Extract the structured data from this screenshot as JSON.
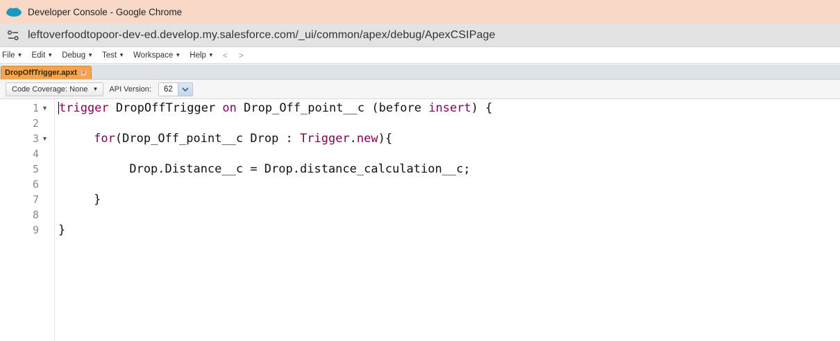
{
  "window": {
    "title": "Developer Console - Google Chrome",
    "url": "leftoverfoodtopoor-dev-ed.develop.my.salesforce.com/_ui/common/apex/debug/ApexCSIPage"
  },
  "menu": {
    "file": "File",
    "edit": "Edit",
    "debug": "Debug",
    "test": "Test",
    "workspace": "Workspace",
    "help": "Help",
    "back": "<",
    "forward": ">"
  },
  "tab": {
    "label": "DropOffTrigger.apxt",
    "close": "✕"
  },
  "toolbar": {
    "coverage_label": "Code Coverage: None",
    "api_label": "API Version:",
    "api_value": "62"
  },
  "code": {
    "line_numbers": [
      "1",
      "2",
      "3",
      "4",
      "5",
      "6",
      "7",
      "8",
      "9"
    ],
    "l1_kw1": "trigger",
    "l1_t1": " DropOffTrigger ",
    "l1_kw2": "on",
    "l1_t2": " Drop_Off_point__c (before ",
    "l1_kw3": "insert",
    "l1_t3": ") {",
    "l3_indent": "     ",
    "l3_kw1": "for",
    "l3_t1": "(Drop_Off_point__c Drop : ",
    "l3_kw2": "Trigger",
    "l3_t2": ".",
    "l3_kw3": "new",
    "l3_t3": "){",
    "l5": "          Drop.Distance__c = Drop.distance_calculation__c;",
    "l7": "     }",
    "l9": "}"
  },
  "colors": {
    "titlebar": "#f8d9c8",
    "tab_active": "#f4a451",
    "keyword": "#7f0055"
  }
}
